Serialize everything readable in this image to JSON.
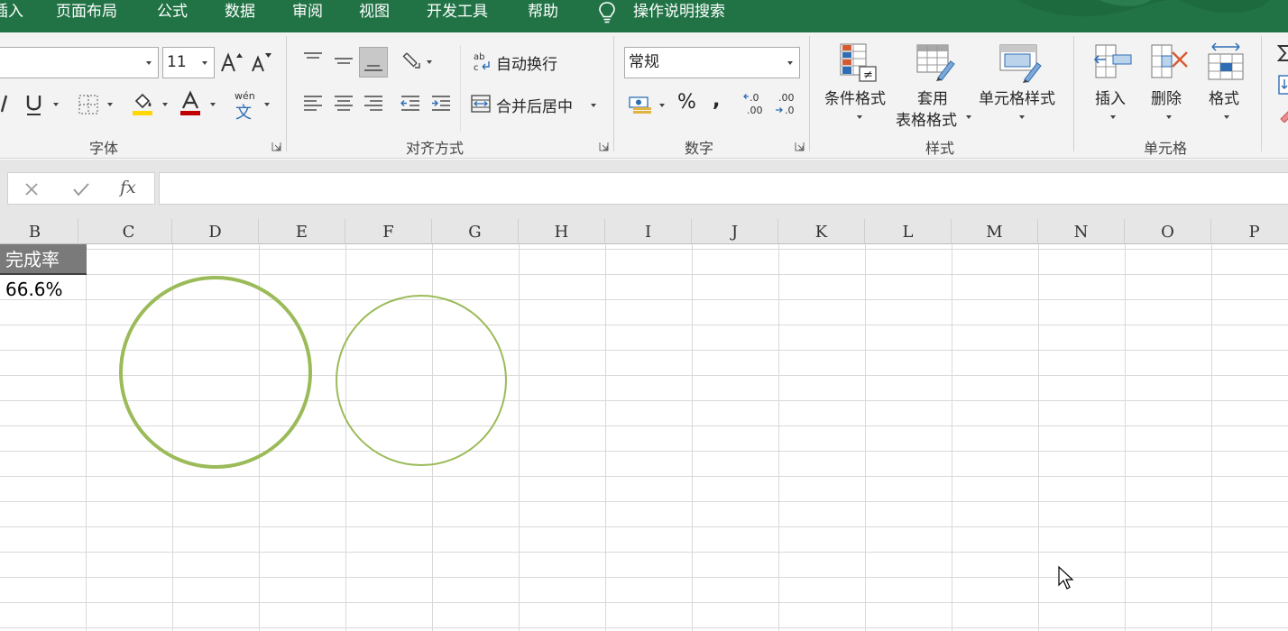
{
  "menu": {
    "tabs": [
      {
        "label": "插入"
      },
      {
        "label": "页面布局"
      },
      {
        "label": "公式"
      },
      {
        "label": "数据"
      },
      {
        "label": "审阅"
      },
      {
        "label": "视图"
      },
      {
        "label": "开发工具"
      },
      {
        "label": "帮助"
      }
    ],
    "tell_me": "操作说明搜索"
  },
  "ribbon": {
    "font": {
      "name_value": "",
      "size_value": "11",
      "phonetic_top": "wén",
      "phonetic_bottom": "文",
      "group_label": "字体",
      "highlight_color": "#ffd800",
      "font_color": "#c00000"
    },
    "alignment": {
      "wrap_text": "自动换行",
      "merge_center": "合并后居中",
      "group_label": "对齐方式"
    },
    "number": {
      "format_value": "常规",
      "percent": "%",
      "comma": ",",
      "group_label": "数字"
    },
    "styles": {
      "conditional": "条件格式",
      "table_line1": "套用",
      "table_line2": "表格格式",
      "cell_styles": "单元格样式",
      "group_label": "样式"
    },
    "cells": {
      "insert": "插入",
      "delete": "删除",
      "format": "格式",
      "group_label": "单元格"
    }
  },
  "formula_bar": {
    "fx": "fx",
    "value": ""
  },
  "sheet": {
    "columns": [
      "B",
      "C",
      "D",
      "E",
      "F",
      "G",
      "H",
      "I",
      "J",
      "K",
      "L",
      "M",
      "N",
      "O",
      "P"
    ],
    "cells": {
      "B1": "完成率",
      "B2": "66.6%"
    },
    "accent": "#9bbb59"
  }
}
